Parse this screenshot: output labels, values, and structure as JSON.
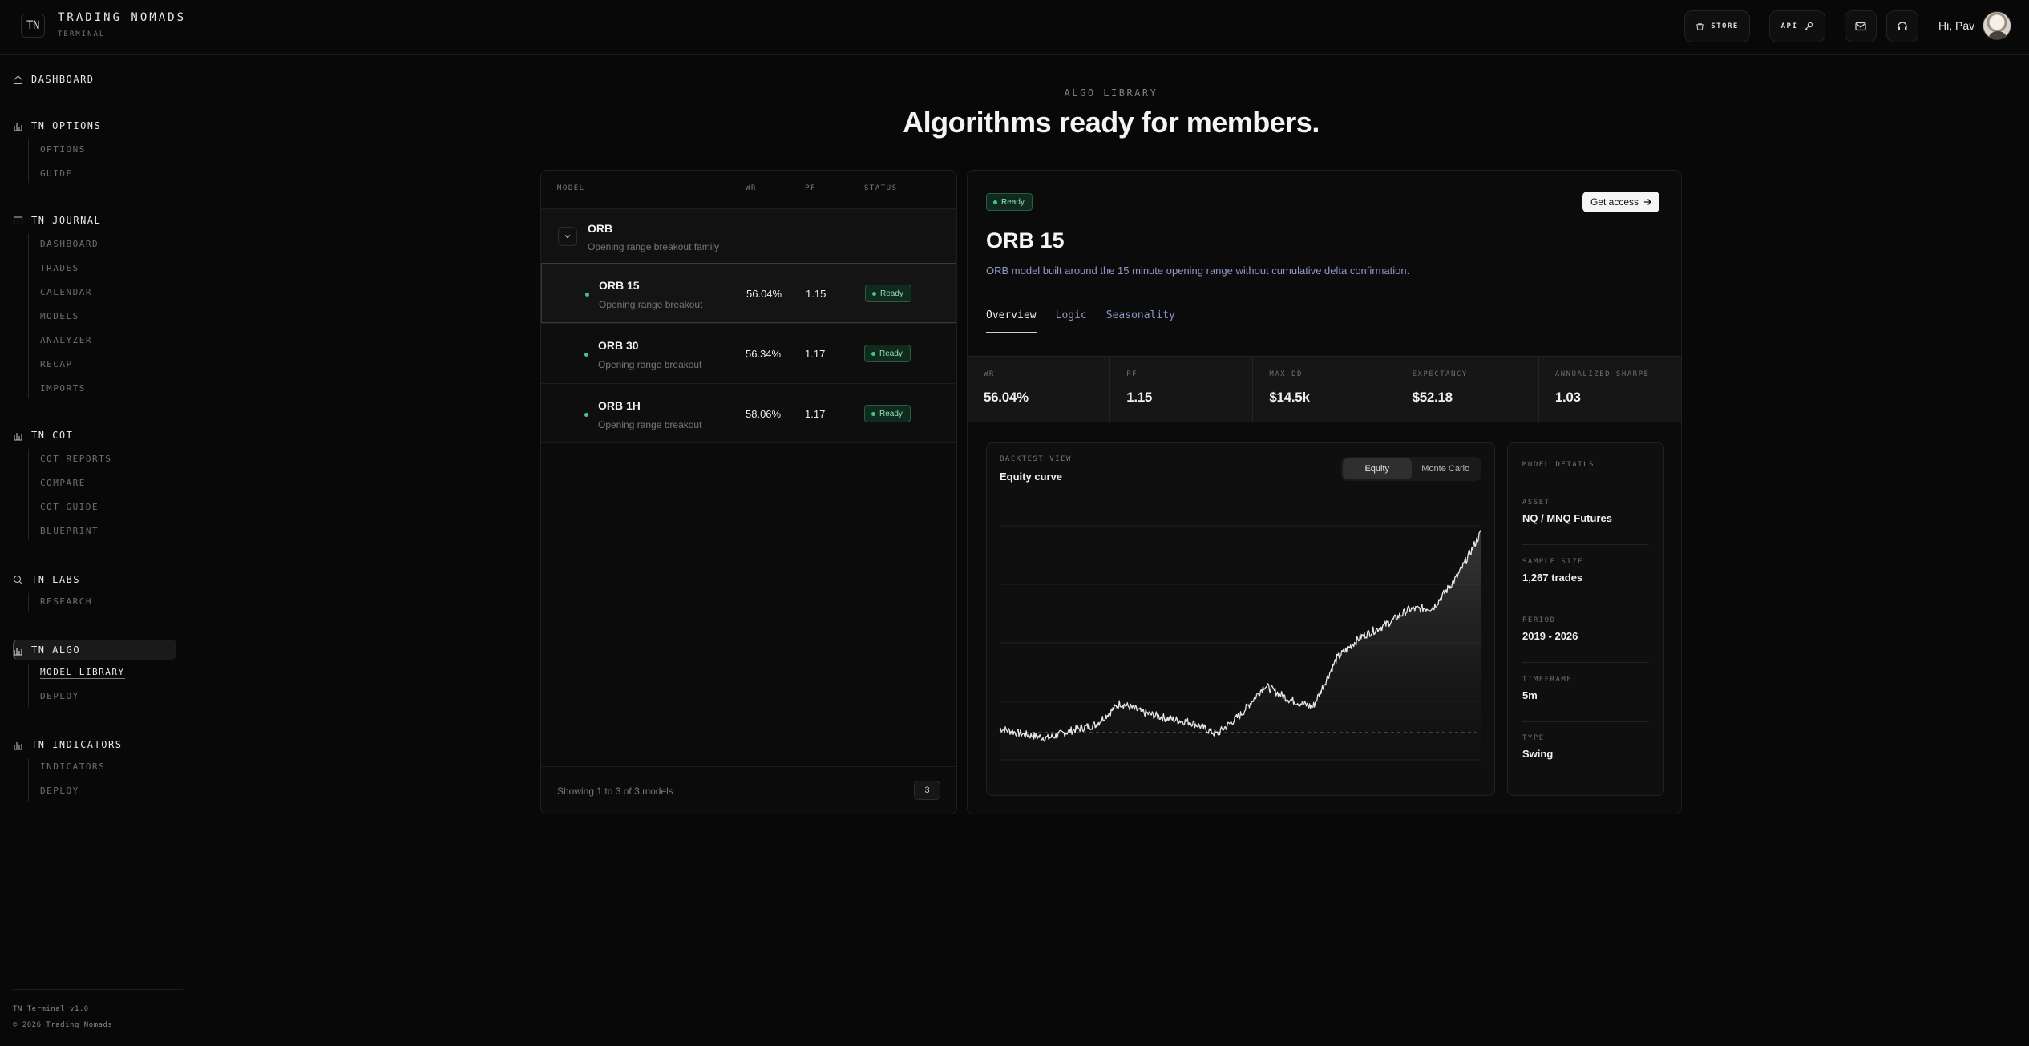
{
  "brand": {
    "logo": "TN",
    "title": "TRADING NOMADS",
    "subtitle": "TERMINAL"
  },
  "topbar": {
    "store_label": "STORE",
    "api_label": "API",
    "greeting": "Hi, Pav",
    "icons": [
      "store-icon",
      "key-icon",
      "mail-icon",
      "headset-icon"
    ]
  },
  "sidebar": {
    "sections": [
      {
        "label": "DASHBOARD",
        "icon": "home-icon",
        "items": []
      },
      {
        "label": "TN OPTIONS",
        "icon": "bar-chart-icon",
        "items": [
          "OPTIONS",
          "GUIDE"
        ]
      },
      {
        "label": "TN JOURNAL",
        "icon": "book-icon",
        "items": [
          "DASHBOARD",
          "TRADES",
          "CALENDAR",
          "MODELS",
          "ANALYZER",
          "RECAP",
          "IMPORTS"
        ]
      },
      {
        "label": "TN COT",
        "icon": "bar-chart-icon",
        "items": [
          "COT REPORTS",
          "COMPARE",
          "COT GUIDE",
          "BLUEPRINT"
        ]
      },
      {
        "label": "TN LABS",
        "icon": "search-icon",
        "items": [
          "RESEARCH"
        ]
      },
      {
        "label": "TN ALGO",
        "icon": "bar-chart-icon",
        "items": [
          "MODEL LIBRARY",
          "DEPLOY"
        ],
        "active": true,
        "active_item": "MODEL LIBRARY"
      },
      {
        "label": "TN INDICATORS",
        "icon": "bar-chart-icon",
        "items": [
          "INDICATORS",
          "DEPLOY"
        ]
      }
    ],
    "footer": {
      "version": "TN Terminal v1.0",
      "copyright": "© 2026 Trading Nomads"
    }
  },
  "header": {
    "eyebrow": "ALGO LIBRARY",
    "title": "Algorithms ready for members."
  },
  "model_table": {
    "columns": [
      "MODEL",
      "WR",
      "PF",
      "STATUS"
    ],
    "group": {
      "name": "ORB",
      "description": "Opening range breakout family"
    },
    "rows": [
      {
        "name": "ORB 15",
        "description": "Opening range breakout",
        "wr": "56.04%",
        "pf": "1.15",
        "status": "Ready",
        "selected": true
      },
      {
        "name": "ORB 30",
        "description": "Opening range breakout",
        "wr": "56.34%",
        "pf": "1.17",
        "status": "Ready"
      },
      {
        "name": "ORB 1H",
        "description": "Opening range breakout",
        "wr": "58.06%",
        "pf": "1.17",
        "status": "Ready"
      }
    ],
    "footer_text": "Showing 1 to 3 of 3 models",
    "page": "3"
  },
  "detail": {
    "status": "Ready",
    "access_label": "Get access",
    "title": "ORB 15",
    "description": "ORB model built around the 15 minute opening range without cumulative delta confirmation.",
    "tabs": [
      "Overview",
      "Logic",
      "Seasonality"
    ],
    "active_tab": "Overview",
    "stats": [
      {
        "label": "WR",
        "value": "56.04%"
      },
      {
        "label": "PF",
        "value": "1.15"
      },
      {
        "label": "MAX DD",
        "value": "$14.5k"
      },
      {
        "label": "EXPECTANCY",
        "value": "$52.18"
      },
      {
        "label": "ANNUALIZED SHARPE",
        "value": "1.03"
      }
    ],
    "chart": {
      "eyebrow": "BACKTEST VIEW",
      "title": "Equity curve",
      "toggle": [
        "Equity",
        "Monte Carlo"
      ],
      "active_toggle": "Equity"
    },
    "model_details": {
      "heading": "MODEL DETAILS",
      "items": [
        {
          "label": "ASSET",
          "value": "NQ / MNQ Futures"
        },
        {
          "label": "SAMPLE SIZE",
          "value": "1,267 trades"
        },
        {
          "label": "PERIOD",
          "value": "2019 - 2026"
        },
        {
          "label": "TIMEFRAME",
          "value": "5m"
        },
        {
          "label": "TYPE",
          "value": "Swing"
        }
      ]
    }
  },
  "chart_data": {
    "type": "line",
    "title": "Equity curve",
    "x": [
      0,
      5,
      10,
      15,
      20,
      25,
      30,
      35,
      40,
      45,
      50,
      55,
      60,
      65,
      70,
      75,
      80,
      85,
      90,
      95,
      100
    ],
    "series": [
      {
        "values": [
          2,
          -1,
          -3,
          1,
          4,
          15,
          10,
          7,
          5,
          -1,
          9,
          24,
          17,
          13,
          38,
          49,
          55,
          63,
          64,
          80,
          103
        ]
      }
    ],
    "baseline": 0,
    "ylim": [
      -10,
      110
    ],
    "grid": true
  },
  "colors": {
    "accent_green": "#3ec98a",
    "bg": "#080808",
    "panel": "#0b0b0b",
    "link_blue": "#8f98c8"
  }
}
